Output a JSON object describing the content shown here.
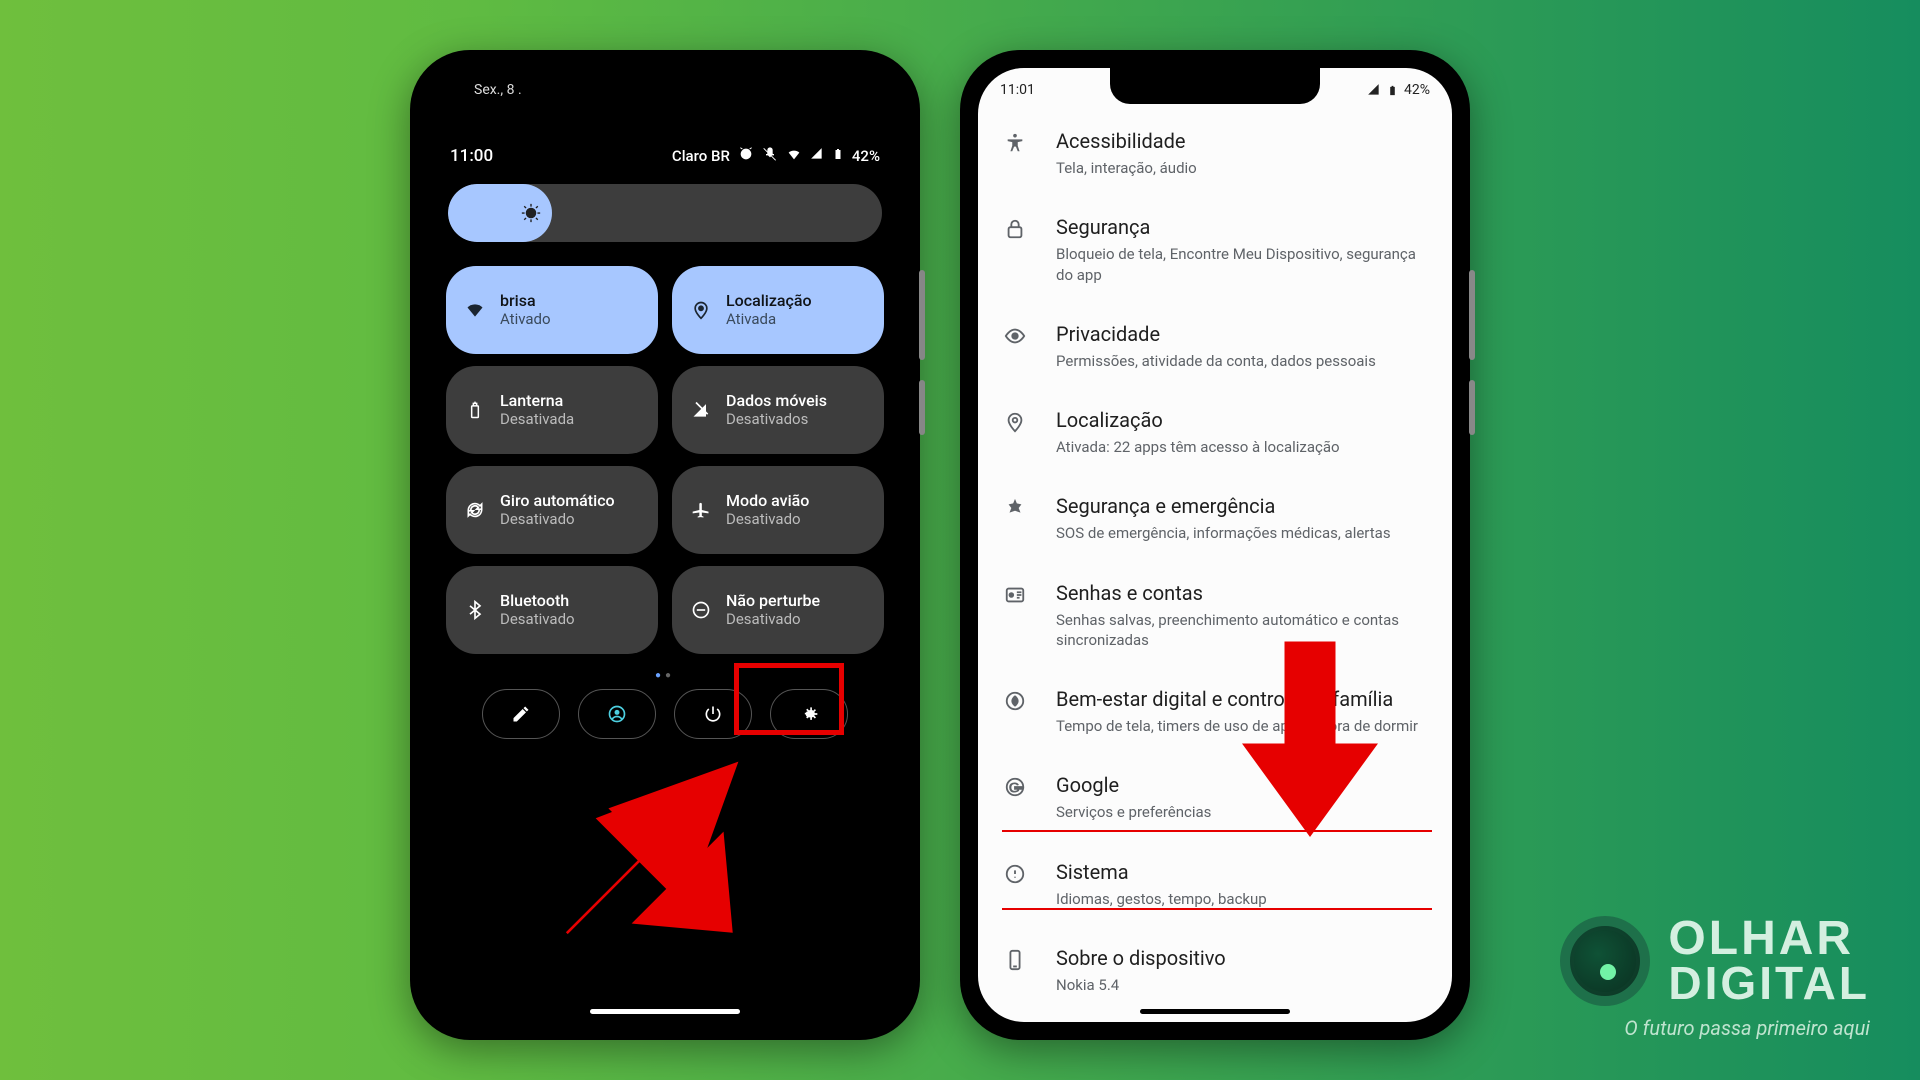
{
  "brand": {
    "line1": "OLHAR",
    "line2": "DIGITAL",
    "tagline": "O futuro passa primeiro aqui"
  },
  "left": {
    "date": "Sex., 8 .",
    "time": "11:00",
    "carrier": "Claro BR",
    "battery": "42%",
    "tiles": [
      {
        "icon": "wifi",
        "title": "brisa",
        "sub": "Ativado",
        "active": true
      },
      {
        "icon": "location",
        "title": "Localização",
        "sub": "Ativada",
        "active": true
      },
      {
        "icon": "flash",
        "title": "Lanterna",
        "sub": "Desativada",
        "active": false
      },
      {
        "icon": "data",
        "title": "Dados móveis",
        "sub": "Desativados",
        "active": false
      },
      {
        "icon": "rotate",
        "title": "Giro automático",
        "sub": "Desativado",
        "active": false
      },
      {
        "icon": "airplane",
        "title": "Modo avião",
        "sub": "Desativado",
        "active": false
      },
      {
        "icon": "bluetooth",
        "title": "Bluetooth",
        "sub": "Desativado",
        "active": false
      },
      {
        "icon": "dnd",
        "title": "Não perturbe",
        "sub": "Desativado",
        "active": false
      }
    ]
  },
  "right": {
    "time": "11:01",
    "battery": "42%",
    "items": [
      {
        "icon": "access",
        "title": "Acessibilidade",
        "sub": "Tela, interação, áudio"
      },
      {
        "icon": "lock",
        "title": "Segurança",
        "sub": "Bloqueio de tela, Encontre Meu Dispositivo, segurança do app"
      },
      {
        "icon": "privacy",
        "title": "Privacidade",
        "sub": "Permissões, atividade da conta, dados pessoais"
      },
      {
        "icon": "location",
        "title": "Localização",
        "sub": "Ativada: 22 apps têm acesso à localização"
      },
      {
        "icon": "emergency",
        "title": "Segurança e emergência",
        "sub": "SOS de emergência, informações médicas, alertas"
      },
      {
        "icon": "passwords",
        "title": "Senhas e contas",
        "sub": "Senhas salvas, preenchimento automático e contas sincronizadas"
      },
      {
        "icon": "wellbeing",
        "title": "Bem-estar digital e controle da família",
        "sub": "Tempo de tela, timers de uso de apps e hora de dormir"
      },
      {
        "icon": "google",
        "title": "Google",
        "sub": "Serviços e preferências"
      },
      {
        "icon": "system",
        "title": "Sistema",
        "sub": "Idiomas, gestos, tempo, backup"
      },
      {
        "icon": "about",
        "title": "Sobre o dispositivo",
        "sub": "Nokia 5.4"
      }
    ]
  }
}
